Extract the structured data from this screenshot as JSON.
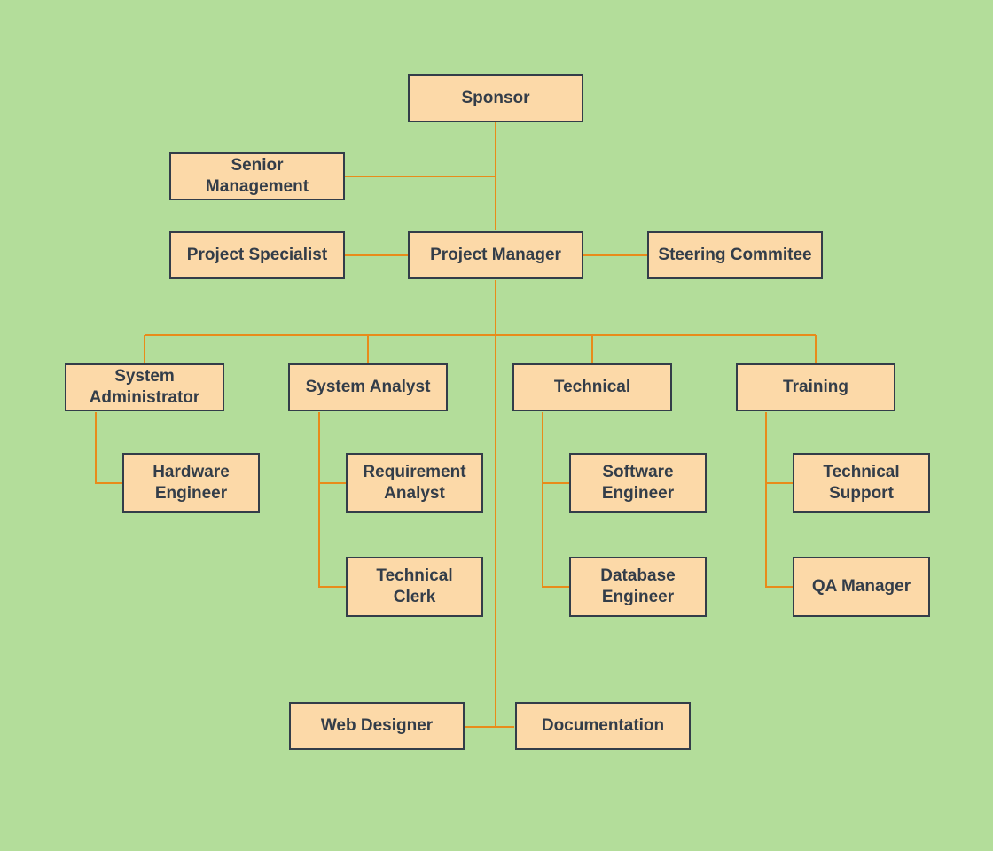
{
  "diagram": {
    "type": "org-chart",
    "nodes": {
      "sponsor": "Sponsor",
      "senior_management": "Senior Management",
      "project_specialist": "Project Specialist",
      "project_manager": "Project Manager",
      "steering_committee": "Steering Commitee",
      "system_administrator": "System Administrator",
      "system_analyst": "System Analyst",
      "technical": "Technical",
      "training": "Training",
      "hardware_engineer": "Hardware Engineer",
      "requirement_analyst": "Requirement Analyst",
      "technical_clerk": "Technical Clerk",
      "software_engineer": "Software Engineer",
      "database_engineer": "Database Engineer",
      "technical_support": "Technical Support",
      "qa_manager": "QA Manager",
      "web_designer": "Web Designer",
      "documentation": "Documentation"
    },
    "edges": [
      [
        "sponsor",
        "project_manager"
      ],
      [
        "senior_management",
        "project_manager"
      ],
      [
        "project_specialist",
        "project_manager"
      ],
      [
        "steering_committee",
        "project_manager"
      ],
      [
        "project_manager",
        "system_administrator"
      ],
      [
        "project_manager",
        "system_analyst"
      ],
      [
        "project_manager",
        "technical"
      ],
      [
        "project_manager",
        "training"
      ],
      [
        "project_manager",
        "web_designer"
      ],
      [
        "project_manager",
        "documentation"
      ],
      [
        "system_administrator",
        "hardware_engineer"
      ],
      [
        "system_analyst",
        "requirement_analyst"
      ],
      [
        "system_analyst",
        "technical_clerk"
      ],
      [
        "technical",
        "software_engineer"
      ],
      [
        "technical",
        "database_engineer"
      ],
      [
        "training",
        "technical_support"
      ],
      [
        "training",
        "qa_manager"
      ]
    ],
    "colors": {
      "background": "#b3dd9a",
      "node_fill": "#fcd9a8",
      "node_border": "#333d49",
      "connector": "#e88b1a"
    }
  }
}
